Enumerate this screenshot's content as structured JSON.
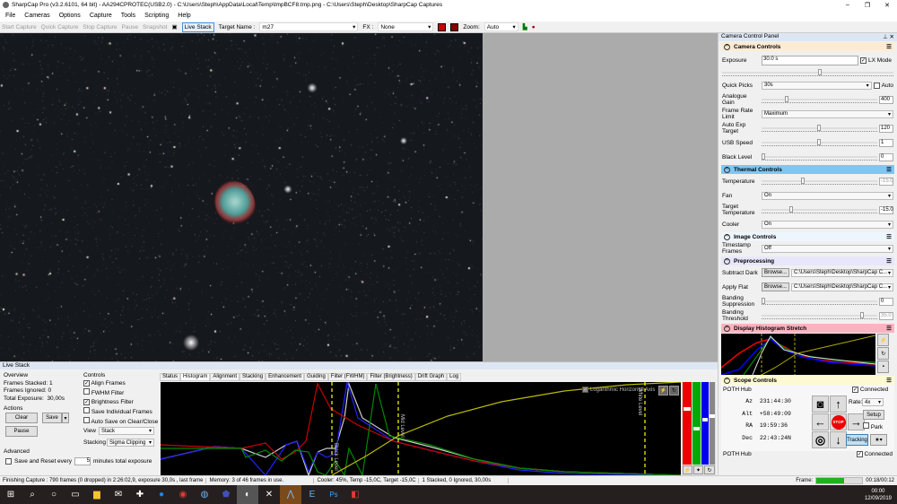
{
  "window": {
    "title": "SharpCap Pro (v3.2.6101, 64 bit) - AA294CPROTEC(USB2.0) - C:\\Users\\Steph\\AppData\\Local\\Temp\\tmpBCF8.tmp.png - C:\\Users\\Steph\\Desktop\\SharpCap Captures"
  },
  "menu": [
    "File",
    "Cameras",
    "Options",
    "Capture",
    "Tools",
    "Scripting",
    "Help"
  ],
  "toolbar": {
    "start_capture": "Start Capture",
    "quick_capture": "Quick Capture",
    "stop_capture": "Stop Capture",
    "pause": "Pause",
    "snapshot": "Snapshot",
    "live_stack": "Live Stack",
    "target_label": "Target Name :",
    "target_value": "m27",
    "fx_label": "FX :",
    "fx_value": "None",
    "zoom_label": "Zoom:",
    "zoom_value": "Auto"
  },
  "panel": {
    "title": "Camera Control Panel",
    "camera": {
      "title": "Camera Controls",
      "exposure_label": "Exposure",
      "exposure": "30.0 s",
      "lx_mode": "LX Mode",
      "quick_picks_label": "Quick Picks",
      "quick_picks": "30s",
      "auto": "Auto",
      "gain_label": "Analogue Gain",
      "gain": "400",
      "frl_label": "Frame Rate Limit",
      "frl": "Maximum",
      "aet_label": "Auto Exp Target",
      "aet": "120",
      "usb_label": "USB Speed",
      "usb": "1",
      "black_label": "Black Level",
      "black": "0"
    },
    "thermal": {
      "title": "Thermal Controls",
      "temp_label": "Temperature",
      "temp": "-15.0",
      "fan_label": "Fan",
      "fan": "On",
      "target_label": "Target Temperature",
      "target": "-15.0",
      "cooler_label": "Cooler",
      "cooler": "On"
    },
    "image": {
      "title": "Image Controls",
      "ts_label": "Timestamp Frames",
      "ts": "Off"
    },
    "pre": {
      "title": "Preprocessing",
      "dark_label": "Subtract Dark",
      "browse": "Browse...",
      "dark": "C:\\Users\\Steph\\Desktop\\SharpCap C...",
      "flat_label": "Apply Flat",
      "flat": "C:\\Users\\Steph\\Desktop\\SharpCap C...",
      "bs_label": "Banding Suppression",
      "bs": "0",
      "bt_label": "Banding Threshold",
      "bt": "35.0"
    },
    "stretch": {
      "title": "Display Histogram Stretch"
    },
    "scope": {
      "title": "Scope Controls",
      "hub": "POTH Hub",
      "connected": "Connected",
      "az_l": "Az",
      "az": "231:44:30",
      "alt_l": "Alt",
      "alt": "+58:49:09",
      "ra_l": "RA",
      "ra": "19:59:36",
      "dec_l": "Dec",
      "dec": "22:43:24N",
      "rate_label": "Rate:",
      "rate": "4x",
      "setup": "Setup",
      "park": "Park",
      "stop": "STOP",
      "tracking": "Tracking",
      "hub2": "POTH Hub",
      "connected2": "Connected"
    },
    "frame_label": "Frame:",
    "frame_progress": 0.6,
    "frame_time": "00:18/00:12"
  },
  "livestack": {
    "title": "Live Stack",
    "overview": "Overview",
    "stacked_l": "Frames Stacked:",
    "stacked": "1",
    "ignored_l": "Frames Ignored:",
    "ignored": "0",
    "exp_l": "Total Exposure:",
    "exp": "30,00s",
    "actions": "Actions",
    "clear": "Clear",
    "save": "Save",
    "pause": "Pause",
    "advanced": "Advanced",
    "save_reset": "Save and Reset every",
    "minutes": "5",
    "minutes_suffix": "minutes total exposure",
    "controls": "Controls",
    "align": "Align Frames",
    "fwhm": "FWHM Filter",
    "bright": "Brightness Filter",
    "save_ind": "Save Individual Frames",
    "autosave": "Auto Save on Clear/Close",
    "view_l": "View",
    "view": "Stack",
    "stacking_l": "Stacking",
    "stacking": "Sigma Clipping",
    "tabs": [
      "Status",
      "Histogram",
      "Alignment",
      "Stacking",
      "Enhancement",
      "Guiding",
      "Filter (FWHM)",
      "Filter (Brightness)",
      "Drift Graph",
      "Log"
    ],
    "active_tab": 1,
    "log_axis": "Logarithmic Horizontal Axis",
    "black_level": "Black Level",
    "mid_level": "Mid Level",
    "white_level": "White Level"
  },
  "status": [
    "Finishing Capture : 790 frames (0 dropped) in 2:26:02,9, exposure 30,0s , last frame",
    "Memory: 3 of 46 frames in use.",
    "Cooler: 45%, Temp -15,0C, Target -15,0C",
    "1 Stacked, 0 Ignored, 30,00s"
  ],
  "taskbar": {
    "time": "00:00",
    "date": "12/09/2019"
  }
}
